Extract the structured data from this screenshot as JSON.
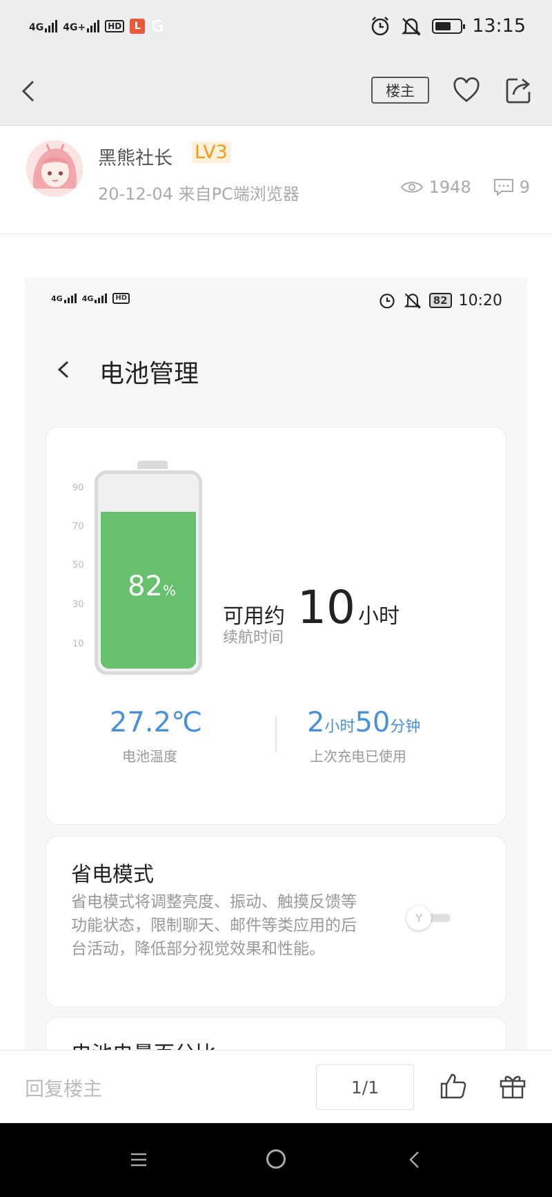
{
  "status_bar": {
    "signal1": "4G",
    "signal2": "4G+",
    "hd": "HD",
    "l_badge": "L",
    "g_badge": "G",
    "time": "13:15",
    "icons": [
      "alarm-icon",
      "mute-icon",
      "battery-icon"
    ]
  },
  "nav": {
    "owner_label": "楼主",
    "icons": [
      "back-arrow-icon",
      "heart-icon",
      "share-icon"
    ]
  },
  "post": {
    "username": "黑熊社长",
    "level": "LV3",
    "meta": "20-12-04   来自PC端浏览器",
    "views": "1948",
    "comments": "9"
  },
  "inner": {
    "signal1": "4G",
    "signal2": "4G",
    "hd": "HD",
    "battery": "82",
    "time": "10:20",
    "title": "电池管理",
    "scale": [
      "90",
      "70",
      "50",
      "30",
      "10"
    ],
    "battery_pct": "82",
    "battery_pct_unit": "%",
    "avail_prefix": "可用约",
    "avail_num": "10",
    "avail_unit": "小时",
    "avail_sub": "续航时间",
    "temp": "27.2℃",
    "temp_label": "电池温度",
    "used_h": "2",
    "used_h_unit": "小时",
    "used_m": "50",
    "used_m_unit": "分钟",
    "used_label": "上次充电已使用",
    "save_title": "省电模式",
    "save_desc": "省电模式将调整亮度、振动、触摸反馈等功能状态，限制聊天、邮件等类应用的后台活动，降低部分视觉效果和性能。",
    "save_toggle_on": false,
    "card3_title": "电池电量百分比"
  },
  "bottom": {
    "reply_placeholder": "回复楼主",
    "page": "1/1"
  },
  "colors": {
    "battery_green": "#66c06e",
    "accent_blue": "#4a90d9",
    "level_orange": "#f39a1e"
  }
}
